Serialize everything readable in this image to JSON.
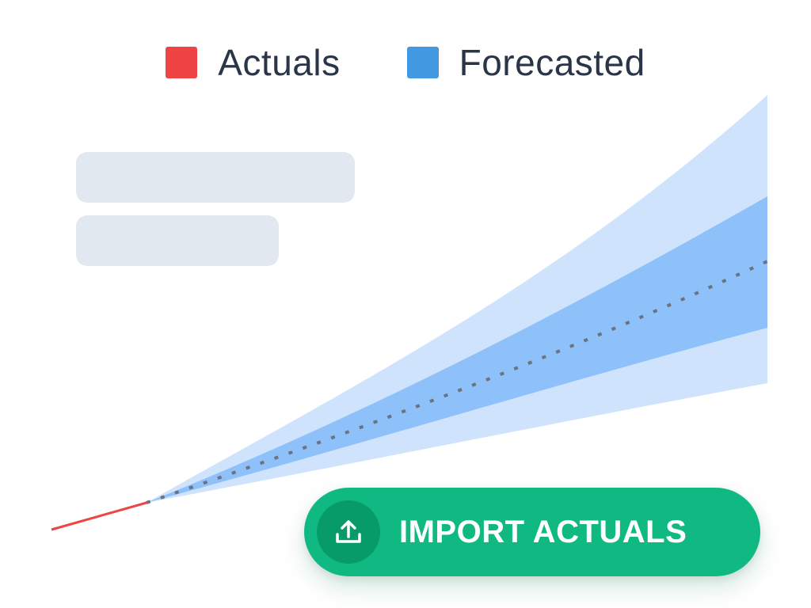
{
  "legend": {
    "actuals_label": "Actuals",
    "forecasted_label": "Forecasted"
  },
  "colors": {
    "actuals": "#ef4444",
    "forecasted": "#4299e1",
    "band_outer": "#cfe3fc",
    "band_inner": "#8ec0fa",
    "forecast_line": "#6b7280",
    "placeholder": "#e2e8f0",
    "button_bg": "#10b981",
    "button_icon_bg": "#079b69",
    "legend_text": "#2a3547"
  },
  "button": {
    "label": "IMPORT ACTUALS",
    "icon": "upload-icon"
  },
  "chart_data": {
    "type": "area",
    "title": "",
    "xlabel": "",
    "ylabel": "",
    "grid": false,
    "legend_position": "top-center",
    "series": [
      {
        "name": "Actuals",
        "style": "solid-line"
      },
      {
        "name": "Forecasted",
        "style": "dotted-line-with-confidence-bands"
      }
    ]
  }
}
